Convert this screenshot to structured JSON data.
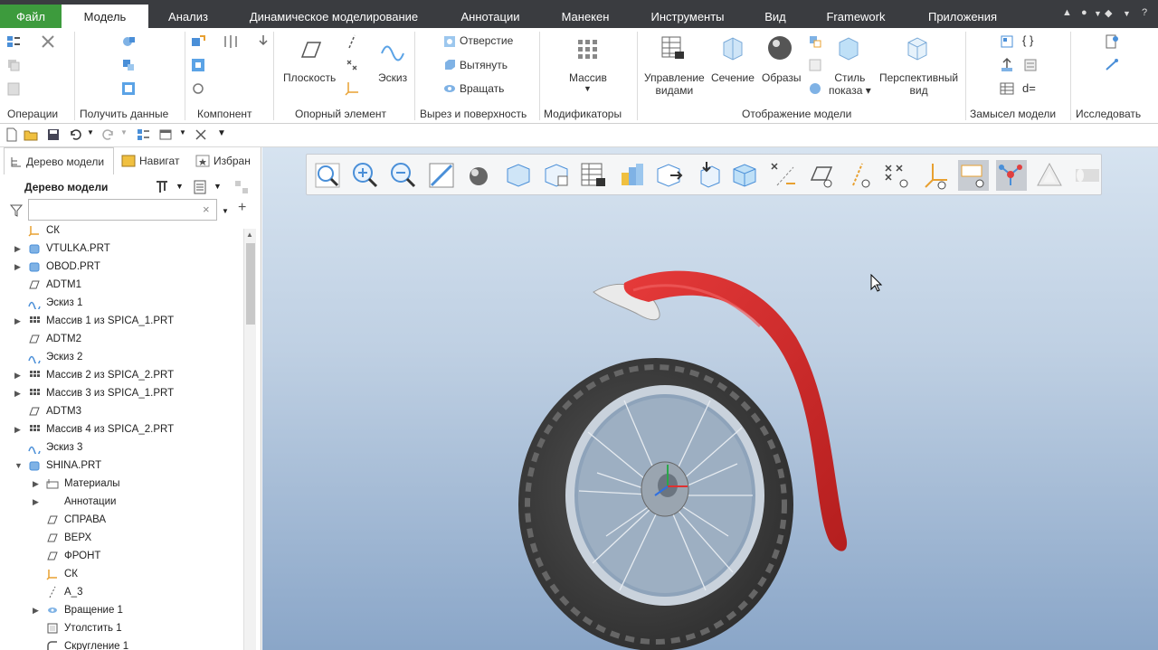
{
  "menubar": {
    "file": "Файл",
    "tabs": [
      "Модель",
      "Анализ",
      "Динамическое моделирование",
      "Аннотации",
      "Манекен",
      "Инструменты",
      "Вид",
      "Framework",
      "Приложения"
    ]
  },
  "ribbon": {
    "groups": [
      "Операции",
      "Получить данные",
      "Компонент",
      "Опорный элемент",
      "Вырез и поверхность",
      "Модификаторы",
      "Отображение модели",
      "Замысел модели",
      "Исследовать"
    ],
    "plane": "Плоскость",
    "sketch": "Эскиз",
    "hole": "Отверстие",
    "extrude": "Вытянуть",
    "revolve": "Вращать",
    "pattern": "Массив",
    "manage_views": [
      "Управление",
      "видами"
    ],
    "section": "Сечение",
    "appearances": "Образы",
    "display_style": [
      "Стиль",
      "показа"
    ],
    "perspective": [
      "Перспективный",
      "вид"
    ],
    "dequal": "d="
  },
  "panel": {
    "tabs": [
      "Дерево модели",
      "Навигат",
      "Избран"
    ],
    "header": "Дерево модели",
    "search_placeholder": ""
  },
  "tree": [
    {
      "label": "СК",
      "icon": "csys",
      "level": 0,
      "expand": ""
    },
    {
      "label": "VTULKA.PRT",
      "icon": "part",
      "level": 0,
      "expand": "▶"
    },
    {
      "label": "OBOD.PRT",
      "icon": "part",
      "level": 0,
      "expand": "▶"
    },
    {
      "label": "ADTM1",
      "icon": "plane",
      "level": 0,
      "expand": ""
    },
    {
      "label": "Эскиз 1",
      "icon": "sketch",
      "level": 0,
      "expand": ""
    },
    {
      "label": "Массив 1 из SPICA_1.PRT",
      "icon": "pattern",
      "level": 0,
      "expand": "▶"
    },
    {
      "label": "ADTM2",
      "icon": "plane",
      "level": 0,
      "expand": ""
    },
    {
      "label": "Эскиз 2",
      "icon": "sketch",
      "level": 0,
      "expand": ""
    },
    {
      "label": "Массив 2 из SPICA_2.PRT",
      "icon": "pattern",
      "level": 0,
      "expand": "▶"
    },
    {
      "label": "Массив 3 из SPICA_1.PRT",
      "icon": "pattern",
      "level": 0,
      "expand": "▶"
    },
    {
      "label": "ADTM3",
      "icon": "plane",
      "level": 0,
      "expand": ""
    },
    {
      "label": "Массив 4 из SPICA_2.PRT",
      "icon": "pattern",
      "level": 0,
      "expand": "▶"
    },
    {
      "label": "Эскиз 3",
      "icon": "sketch",
      "level": 0,
      "expand": ""
    },
    {
      "label": "SHINA.PRT",
      "icon": "part",
      "level": 0,
      "expand": "▼"
    },
    {
      "label": "Материалы",
      "icon": "folder",
      "level": 1,
      "expand": "▶"
    },
    {
      "label": "Аннотации",
      "icon": "none",
      "level": 1,
      "expand": "▶"
    },
    {
      "label": "СПРАВА",
      "icon": "plane",
      "level": 1,
      "expand": ""
    },
    {
      "label": "ВЕРХ",
      "icon": "plane",
      "level": 1,
      "expand": ""
    },
    {
      "label": "ФРОНТ",
      "icon": "plane",
      "level": 1,
      "expand": ""
    },
    {
      "label": "СК",
      "icon": "csys",
      "level": 1,
      "expand": ""
    },
    {
      "label": "A_3",
      "icon": "axis",
      "level": 1,
      "expand": ""
    },
    {
      "label": "Вращение 1",
      "icon": "revolve",
      "level": 1,
      "expand": "▶"
    },
    {
      "label": "Утолстить 1",
      "icon": "thicken",
      "level": 1,
      "expand": ""
    },
    {
      "label": "Скругление 1",
      "icon": "round",
      "level": 1,
      "expand": ""
    }
  ],
  "colors": {
    "menubar": "#3a3c40",
    "file_tab": "#3d9b3d",
    "fender": "#d42a2a",
    "viewport_top": "#d6e3f0",
    "viewport_bottom": "#8aa6c8"
  }
}
